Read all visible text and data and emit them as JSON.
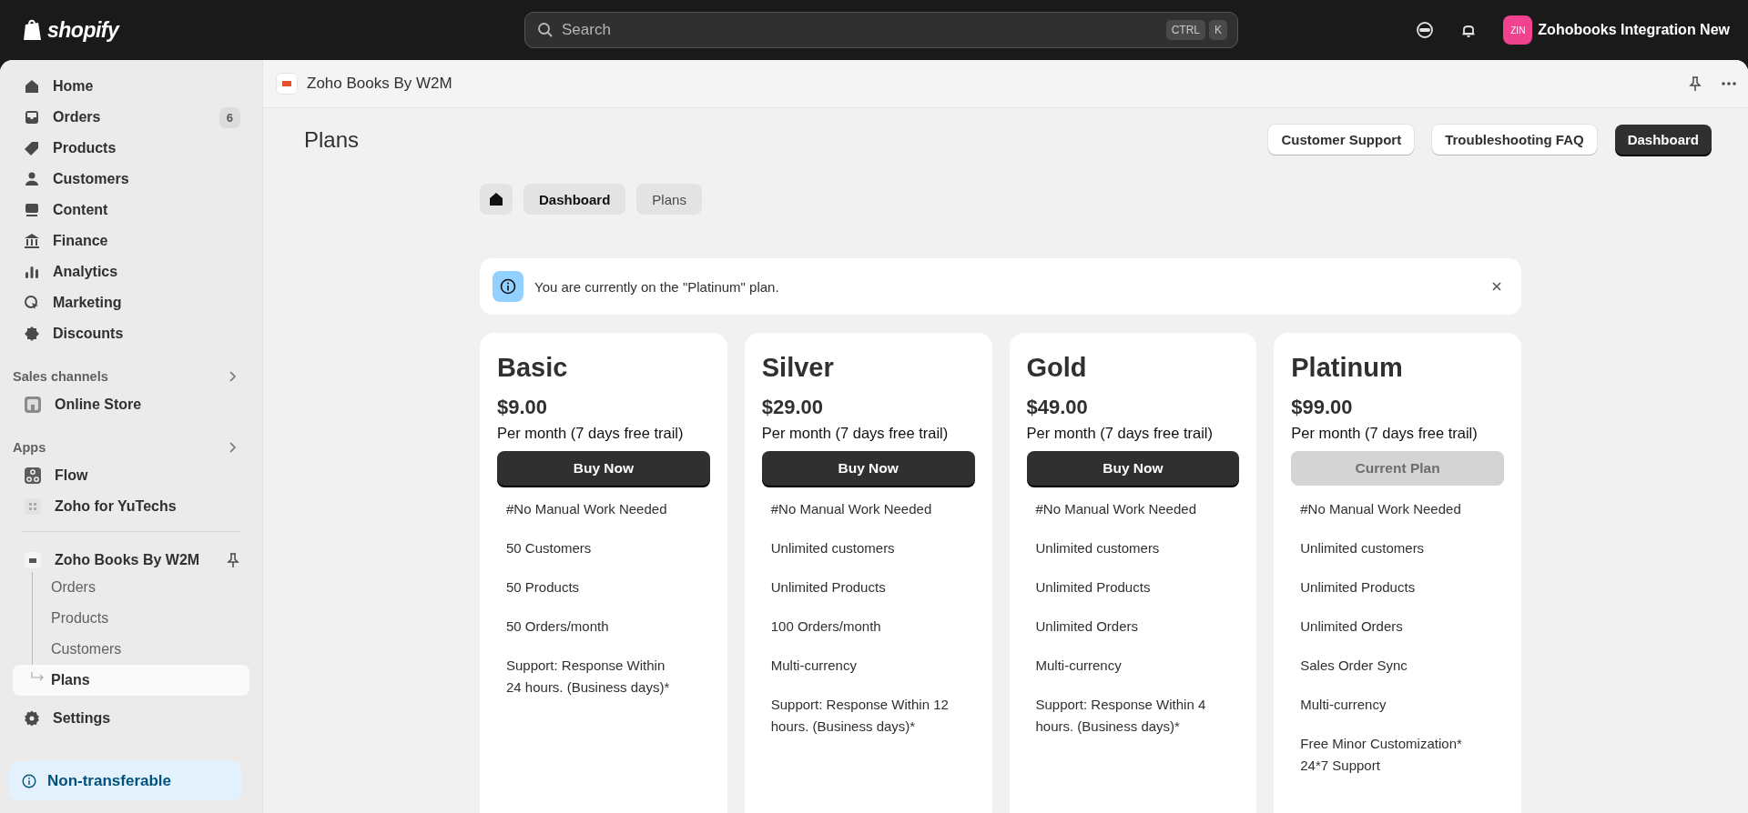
{
  "topbar": {
    "brand": "shopify",
    "search": {
      "placeholder": "Search",
      "keys": [
        "CTRL",
        "K"
      ]
    },
    "store": {
      "initials": "ZIN",
      "name": "Zohobooks Integration New"
    }
  },
  "sidebar": {
    "items": [
      {
        "label": "Home",
        "selected": false
      },
      {
        "label": "Orders",
        "badge": "6",
        "selected": false
      },
      {
        "label": "Products",
        "selected": false
      },
      {
        "label": "Customers",
        "selected": false
      },
      {
        "label": "Content",
        "selected": false
      },
      {
        "label": "Finance",
        "selected": false
      },
      {
        "label": "Analytics",
        "selected": false
      },
      {
        "label": "Marketing",
        "selected": false
      },
      {
        "label": "Discounts",
        "selected": false
      }
    ],
    "sales_channels": {
      "title": "Sales channels",
      "items": [
        {
          "label": "Online Store",
          "selected": false
        }
      ]
    },
    "apps": {
      "title": "Apps",
      "items": [
        {
          "label": "Flow",
          "selected": false
        },
        {
          "label": "Zoho for YuTechs",
          "selected": false
        }
      ]
    },
    "pinned_app": {
      "label": "Zoho Books By W2M",
      "children": [
        {
          "label": "Orders",
          "selected": false
        },
        {
          "label": "Products",
          "selected": false
        },
        {
          "label": "Customers",
          "selected": false
        },
        {
          "label": "Plans",
          "selected": true
        }
      ]
    },
    "settings": "Settings",
    "notice": "Non-transferable"
  },
  "app_header": {
    "title": "Zoho Books By W2M"
  },
  "page": {
    "title": "Plans",
    "actions": [
      {
        "label": "Customer Support",
        "primary": false
      },
      {
        "label": "Troubleshooting FAQ",
        "primary": false
      },
      {
        "label": "Dashboard",
        "primary": true
      }
    ]
  },
  "breadcrumbs": [
    {
      "label": "Dashboard",
      "selected": true
    },
    {
      "label": "Plans",
      "selected": false
    }
  ],
  "banner": {
    "text": "You are currently on the \"Platinum\" plan."
  },
  "plans": [
    {
      "name": "Basic",
      "price": "$9.00",
      "period": "Per month (7 days free trail)",
      "button": "Buy Now",
      "current": false,
      "features": [
        "#No Manual Work Needed",
        "50 Customers",
        "50 Products",
        "50 Orders/month",
        "Support: Response Within\n24 hours. (Business days)*"
      ]
    },
    {
      "name": "Silver",
      "price": "$29.00",
      "period": "Per month (7 days free trail)",
      "button": "Buy Now",
      "current": false,
      "features": [
        "#No Manual Work Needed",
        "Unlimited customers",
        "Unlimited Products",
        "100 Orders/month",
        "Multi-currency",
        "Support: Response Within 12\nhours. (Business days)*"
      ]
    },
    {
      "name": "Gold",
      "price": "$49.00",
      "period": "Per month (7 days free trail)",
      "button": "Buy Now",
      "current": false,
      "features": [
        "#No Manual Work Needed",
        "Unlimited customers",
        "Unlimited Products",
        "Unlimited Orders",
        "Multi-currency",
        "Support: Response Within 4\nhours. (Business days)*"
      ]
    },
    {
      "name": "Platinum",
      "price": "$99.00",
      "period": "Per month (7 days free trail)",
      "button": "Current Plan",
      "current": true,
      "features": [
        "#No Manual Work Needed",
        "Unlimited customers",
        "Unlimited Products",
        "Unlimited Orders",
        "Sales Order Sync",
        "Multi-currency",
        "Free Minor Customization*\n24*7 Support"
      ]
    }
  ]
}
